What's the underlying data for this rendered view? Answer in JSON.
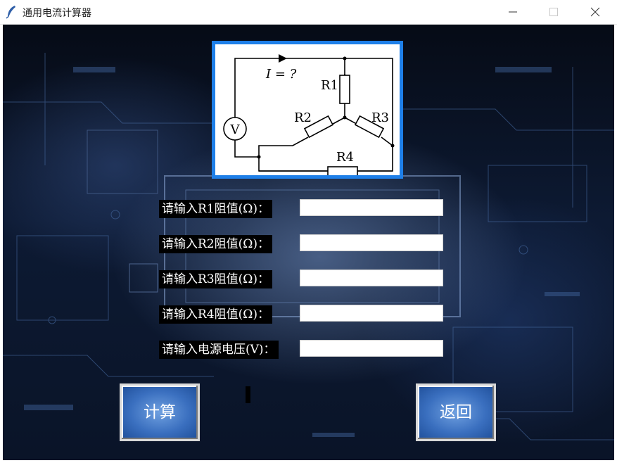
{
  "window": {
    "title": "通用电流计算器",
    "icon": "feather-icon",
    "controls": [
      "minimize-icon",
      "maximize-icon",
      "close-icon"
    ]
  },
  "diagram": {
    "current_label": "I = ?",
    "voltmeter_label": "V",
    "resistors": [
      "R1",
      "R2",
      "R3",
      "R4"
    ]
  },
  "form": {
    "fields": [
      {
        "label": "请输入R1阻值(Ω)：",
        "value": ""
      },
      {
        "label": "请输入R2阻值(Ω)：",
        "value": ""
      },
      {
        "label": "请输入R3阻值(Ω)：",
        "value": ""
      },
      {
        "label": "请输入R4阻值(Ω)：",
        "value": ""
      },
      {
        "label": "请输入电源电压(V)：",
        "value": ""
      }
    ]
  },
  "result": {
    "text": ""
  },
  "buttons": {
    "calculate": "计算",
    "back": "返回"
  },
  "colors": {
    "diagram_border": "#1e7fe8",
    "button_face": "#3a6fbf",
    "label_bg": "#000000"
  }
}
